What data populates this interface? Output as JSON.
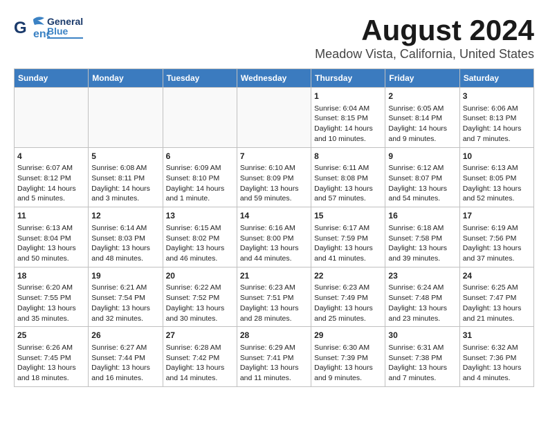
{
  "logo": {
    "line1": "General",
    "line2": "Blue"
  },
  "title": "August 2024",
  "subtitle": "Meadow Vista, California, United States",
  "days_of_week": [
    "Sunday",
    "Monday",
    "Tuesday",
    "Wednesday",
    "Thursday",
    "Friday",
    "Saturday"
  ],
  "weeks": [
    [
      {
        "day": "",
        "data": ""
      },
      {
        "day": "",
        "data": ""
      },
      {
        "day": "",
        "data": ""
      },
      {
        "day": "",
        "data": ""
      },
      {
        "day": "1",
        "data": "Sunrise: 6:04 AM\nSunset: 8:15 PM\nDaylight: 14 hours\nand 10 minutes."
      },
      {
        "day": "2",
        "data": "Sunrise: 6:05 AM\nSunset: 8:14 PM\nDaylight: 14 hours\nand 9 minutes."
      },
      {
        "day": "3",
        "data": "Sunrise: 6:06 AM\nSunset: 8:13 PM\nDaylight: 14 hours\nand 7 minutes."
      }
    ],
    [
      {
        "day": "4",
        "data": "Sunrise: 6:07 AM\nSunset: 8:12 PM\nDaylight: 14 hours\nand 5 minutes."
      },
      {
        "day": "5",
        "data": "Sunrise: 6:08 AM\nSunset: 8:11 PM\nDaylight: 14 hours\nand 3 minutes."
      },
      {
        "day": "6",
        "data": "Sunrise: 6:09 AM\nSunset: 8:10 PM\nDaylight: 14 hours\nand 1 minute."
      },
      {
        "day": "7",
        "data": "Sunrise: 6:10 AM\nSunset: 8:09 PM\nDaylight: 13 hours\nand 59 minutes."
      },
      {
        "day": "8",
        "data": "Sunrise: 6:11 AM\nSunset: 8:08 PM\nDaylight: 13 hours\nand 57 minutes."
      },
      {
        "day": "9",
        "data": "Sunrise: 6:12 AM\nSunset: 8:07 PM\nDaylight: 13 hours\nand 54 minutes."
      },
      {
        "day": "10",
        "data": "Sunrise: 6:13 AM\nSunset: 8:05 PM\nDaylight: 13 hours\nand 52 minutes."
      }
    ],
    [
      {
        "day": "11",
        "data": "Sunrise: 6:13 AM\nSunset: 8:04 PM\nDaylight: 13 hours\nand 50 minutes."
      },
      {
        "day": "12",
        "data": "Sunrise: 6:14 AM\nSunset: 8:03 PM\nDaylight: 13 hours\nand 48 minutes."
      },
      {
        "day": "13",
        "data": "Sunrise: 6:15 AM\nSunset: 8:02 PM\nDaylight: 13 hours\nand 46 minutes."
      },
      {
        "day": "14",
        "data": "Sunrise: 6:16 AM\nSunset: 8:00 PM\nDaylight: 13 hours\nand 44 minutes."
      },
      {
        "day": "15",
        "data": "Sunrise: 6:17 AM\nSunset: 7:59 PM\nDaylight: 13 hours\nand 41 minutes."
      },
      {
        "day": "16",
        "data": "Sunrise: 6:18 AM\nSunset: 7:58 PM\nDaylight: 13 hours\nand 39 minutes."
      },
      {
        "day": "17",
        "data": "Sunrise: 6:19 AM\nSunset: 7:56 PM\nDaylight: 13 hours\nand 37 minutes."
      }
    ],
    [
      {
        "day": "18",
        "data": "Sunrise: 6:20 AM\nSunset: 7:55 PM\nDaylight: 13 hours\nand 35 minutes."
      },
      {
        "day": "19",
        "data": "Sunrise: 6:21 AM\nSunset: 7:54 PM\nDaylight: 13 hours\nand 32 minutes."
      },
      {
        "day": "20",
        "data": "Sunrise: 6:22 AM\nSunset: 7:52 PM\nDaylight: 13 hours\nand 30 minutes."
      },
      {
        "day": "21",
        "data": "Sunrise: 6:23 AM\nSunset: 7:51 PM\nDaylight: 13 hours\nand 28 minutes."
      },
      {
        "day": "22",
        "data": "Sunrise: 6:23 AM\nSunset: 7:49 PM\nDaylight: 13 hours\nand 25 minutes."
      },
      {
        "day": "23",
        "data": "Sunrise: 6:24 AM\nSunset: 7:48 PM\nDaylight: 13 hours\nand 23 minutes."
      },
      {
        "day": "24",
        "data": "Sunrise: 6:25 AM\nSunset: 7:47 PM\nDaylight: 13 hours\nand 21 minutes."
      }
    ],
    [
      {
        "day": "25",
        "data": "Sunrise: 6:26 AM\nSunset: 7:45 PM\nDaylight: 13 hours\nand 18 minutes."
      },
      {
        "day": "26",
        "data": "Sunrise: 6:27 AM\nSunset: 7:44 PM\nDaylight: 13 hours\nand 16 minutes."
      },
      {
        "day": "27",
        "data": "Sunrise: 6:28 AM\nSunset: 7:42 PM\nDaylight: 13 hours\nand 14 minutes."
      },
      {
        "day": "28",
        "data": "Sunrise: 6:29 AM\nSunset: 7:41 PM\nDaylight: 13 hours\nand 11 minutes."
      },
      {
        "day": "29",
        "data": "Sunrise: 6:30 AM\nSunset: 7:39 PM\nDaylight: 13 hours\nand 9 minutes."
      },
      {
        "day": "30",
        "data": "Sunrise: 6:31 AM\nSunset: 7:38 PM\nDaylight: 13 hours\nand 7 minutes."
      },
      {
        "day": "31",
        "data": "Sunrise: 6:32 AM\nSunset: 7:36 PM\nDaylight: 13 hours\nand 4 minutes."
      }
    ]
  ]
}
